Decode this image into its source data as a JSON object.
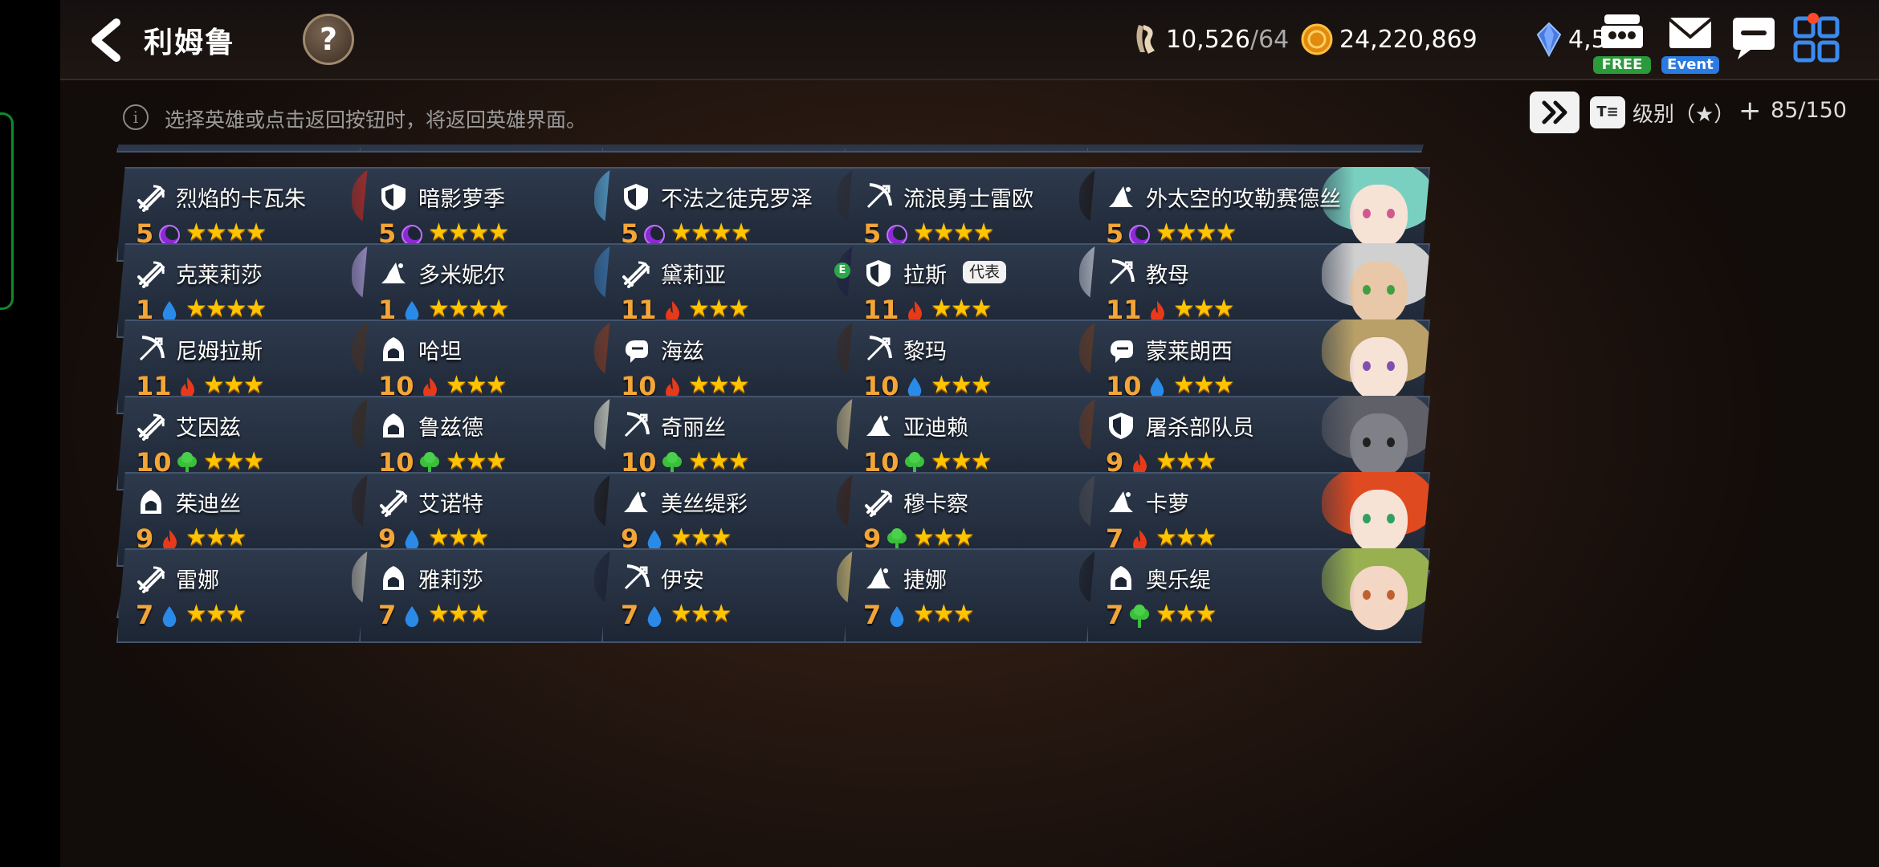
{
  "header": {
    "title": "利姆鲁",
    "help_glyph": "?",
    "resources": [
      {
        "icon": "horseshoe-icon",
        "value": "10,526",
        "max": "/64"
      },
      {
        "icon": "gold-coin-icon",
        "value": "24,220,869"
      },
      {
        "icon": "crystal-icon",
        "value": "4,582"
      }
    ],
    "free_label": "FREE",
    "event_label": "Event"
  },
  "infobar": {
    "message": "选择英雄或点击返回按钮时，将返回英雄界面。",
    "sort_icon_text": "T≡",
    "sort_label": "级别（★）",
    "capacity": "85/150"
  },
  "colors": {
    "level": "#f3a537",
    "star": "#ffc400",
    "card_bg": "#26303f"
  },
  "heroes": [
    {
      "name": "烈焰的卡瓦朱",
      "level": "5",
      "element": "dark",
      "stars": "★★★★",
      "class": "warrior-icon",
      "hair": "#c6281e",
      "skin": "#8a5a3a",
      "eye": "#e8c020"
    },
    {
      "name": "暗影萝季",
      "level": "5",
      "element": "dark",
      "stars": "★★★★",
      "class": "knight-icon",
      "hair": "#5aaee0",
      "skin": "#f6e0d4",
      "eye": "#d12a2a"
    },
    {
      "name": "不法之徒克罗泽",
      "level": "5",
      "element": "dark",
      "stars": "★★★★",
      "class": "knight-icon",
      "hair": "#2a2a30",
      "skin": "#e4b696",
      "eye": "#402020"
    },
    {
      "name": "流浪勇士雷欧",
      "level": "5",
      "element": "dark",
      "stars": "★★★★",
      "class": "archer-icon",
      "hair": "#1a1414",
      "skin": "#f0cba8",
      "eye": "#d8a020"
    },
    {
      "name": "外太空的攻勒赛德丝",
      "level": "5",
      "element": "dark",
      "stars": "★★★★",
      "class": "mage-icon",
      "hair": "#7ad0c0",
      "skin": "#f7e2d6",
      "eye": "#d05890"
    },
    {
      "name": "克莱莉莎",
      "level": "1",
      "element": "water",
      "stars": "★★★★",
      "class": "warrior-icon",
      "hair": "#b6a0e0",
      "skin": "#f7e2d6",
      "eye": "#6a5aa0"
    },
    {
      "name": "多米妮尔",
      "level": "1",
      "element": "water",
      "stars": "★★★★",
      "class": "mage-icon",
      "hair": "#3a7ab8",
      "skin": "#f3d6c3",
      "eye": "#2a6ab0"
    },
    {
      "name": "黛莉亚",
      "level": "11",
      "element": "fire",
      "stars": "★★★",
      "class": "warrior-icon",
      "hair": "#1e1e40",
      "skin": "#f4d8c8",
      "eye": "#3a8ad0"
    },
    {
      "name": "拉斯",
      "level": "11",
      "element": "fire",
      "stars": "★★★",
      "class": "knight-icon",
      "hair": "#c8ccd8",
      "skin": "#f7e2d6",
      "eye": "#4a7ac0",
      "badge": "代表",
      "e_mark": "E"
    },
    {
      "name": "教母",
      "level": "11",
      "element": "fire",
      "stars": "★★★",
      "class": "archer-icon",
      "hair": "#d0d0d0",
      "skin": "#e8c8a8",
      "eye": "#40a040"
    },
    {
      "name": "尼姆拉斯",
      "level": "11",
      "element": "fire",
      "stars": "★★★",
      "class": "archer-icon",
      "hair": "#4a3020",
      "skin": "#f3d6c3",
      "eye": "#603020"
    },
    {
      "name": "哈坦",
      "level": "10",
      "element": "fire",
      "stars": "★★★",
      "class": "assassin-icon",
      "hair": "#8a3a20",
      "skin": "#a85a30",
      "eye": "#e02020"
    },
    {
      "name": "海兹",
      "level": "10",
      "element": "fire",
      "stars": "★★★",
      "class": "fighter-icon",
      "hair": "#3a2820",
      "skin": "#f3d6c3",
      "eye": "#303030"
    },
    {
      "name": "黎玛",
      "level": "10",
      "element": "water",
      "stars": "★★★",
      "class": "archer-icon",
      "hair": "#6a3a20",
      "skin": "#f3d6c3",
      "eye": "#3a7ad0"
    },
    {
      "name": "蒙莱朗西",
      "level": "10",
      "element": "water",
      "stars": "★★★",
      "class": "fighter-icon",
      "hair": "#b8a068",
      "skin": "#f7e2d6",
      "eye": "#8050b0"
    },
    {
      "name": "艾因兹",
      "level": "10",
      "element": "wood",
      "stars": "★★★",
      "class": "warrior-icon",
      "hair": "#3a2a1a",
      "skin": "#c08860",
      "eye": "#402010"
    },
    {
      "name": "鲁兹德",
      "level": "10",
      "element": "wood",
      "stars": "★★★",
      "class": "assassin-icon",
      "hair": "#e0e0d0",
      "skin": "#d8d8c8",
      "eye": "#202020"
    },
    {
      "name": "奇丽丝",
      "level": "10",
      "element": "wood",
      "stars": "★★★",
      "class": "archer-icon",
      "hair": "#c8b888",
      "skin": "#f7e2d6",
      "eye": "#608040"
    },
    {
      "name": "亚迪赖",
      "level": "10",
      "element": "wood",
      "stars": "★★★",
      "class": "mage-icon",
      "hair": "#6a3a20",
      "skin": "#e8b890",
      "eye": "#402010"
    },
    {
      "name": "屠杀部队员",
      "level": "9",
      "element": "fire",
      "stars": "★★★",
      "class": "knight-icon",
      "hair": "#606068",
      "skin": "#808088",
      "eye": "#202020"
    },
    {
      "name": "茱迪丝",
      "level": "9",
      "element": "fire",
      "stars": "★★★",
      "class": "assassin-icon",
      "hair": "#2a2020",
      "skin": "#f7e2d6",
      "eye": "#a02030"
    },
    {
      "name": "艾诺特",
      "level": "9",
      "element": "water",
      "stars": "★★★",
      "class": "warrior-icon",
      "hair": "#181414",
      "skin": "#e8c0a0",
      "eye": "#301010"
    },
    {
      "name": "美丝缇彩",
      "level": "9",
      "element": "water",
      "stars": "★★★",
      "class": "mage-icon",
      "hair": "#3a2018",
      "skin": "#f7e2d6",
      "eye": "#30b070"
    },
    {
      "name": "穆卡察",
      "level": "9",
      "element": "wood",
      "stars": "★★★",
      "class": "warrior-icon",
      "hair": "#4a4a50",
      "skin": "#686870",
      "eye": "#e0e040"
    },
    {
      "name": "卡萝",
      "level": "7",
      "element": "fire",
      "stars": "★★★",
      "class": "mage-icon",
      "hair": "#e04a20",
      "skin": "#f7e2d6",
      "eye": "#30a060"
    },
    {
      "name": "雷娜",
      "level": "7",
      "element": "water",
      "stars": "★★★",
      "class": "warrior-icon",
      "hair": "#c0bcb0",
      "skin": "#f3d6c3",
      "eye": "#5a6a80"
    },
    {
      "name": "雅莉莎",
      "level": "7",
      "element": "water",
      "stars": "★★★",
      "class": "assassin-icon",
      "hair": "#1a2030",
      "skin": "#f3d6c3",
      "eye": "#3a8a90"
    },
    {
      "name": "伊安",
      "level": "7",
      "element": "water",
      "stars": "★★★",
      "class": "archer-icon",
      "hair": "#d8c070",
      "skin": "#f3d6c3",
      "eye": "#506080"
    },
    {
      "name": "捷娜",
      "level": "7",
      "element": "water",
      "stars": "★★★",
      "class": "mage-icon",
      "hair": "#181820",
      "skin": "#f3d6c3",
      "eye": "#3a3a80"
    },
    {
      "name": "奥乐缇",
      "level": "7",
      "element": "wood",
      "stars": "★★★",
      "class": "assassin-icon",
      "hair": "#98b050",
      "skin": "#f3d6c3",
      "eye": "#c06030"
    }
  ]
}
